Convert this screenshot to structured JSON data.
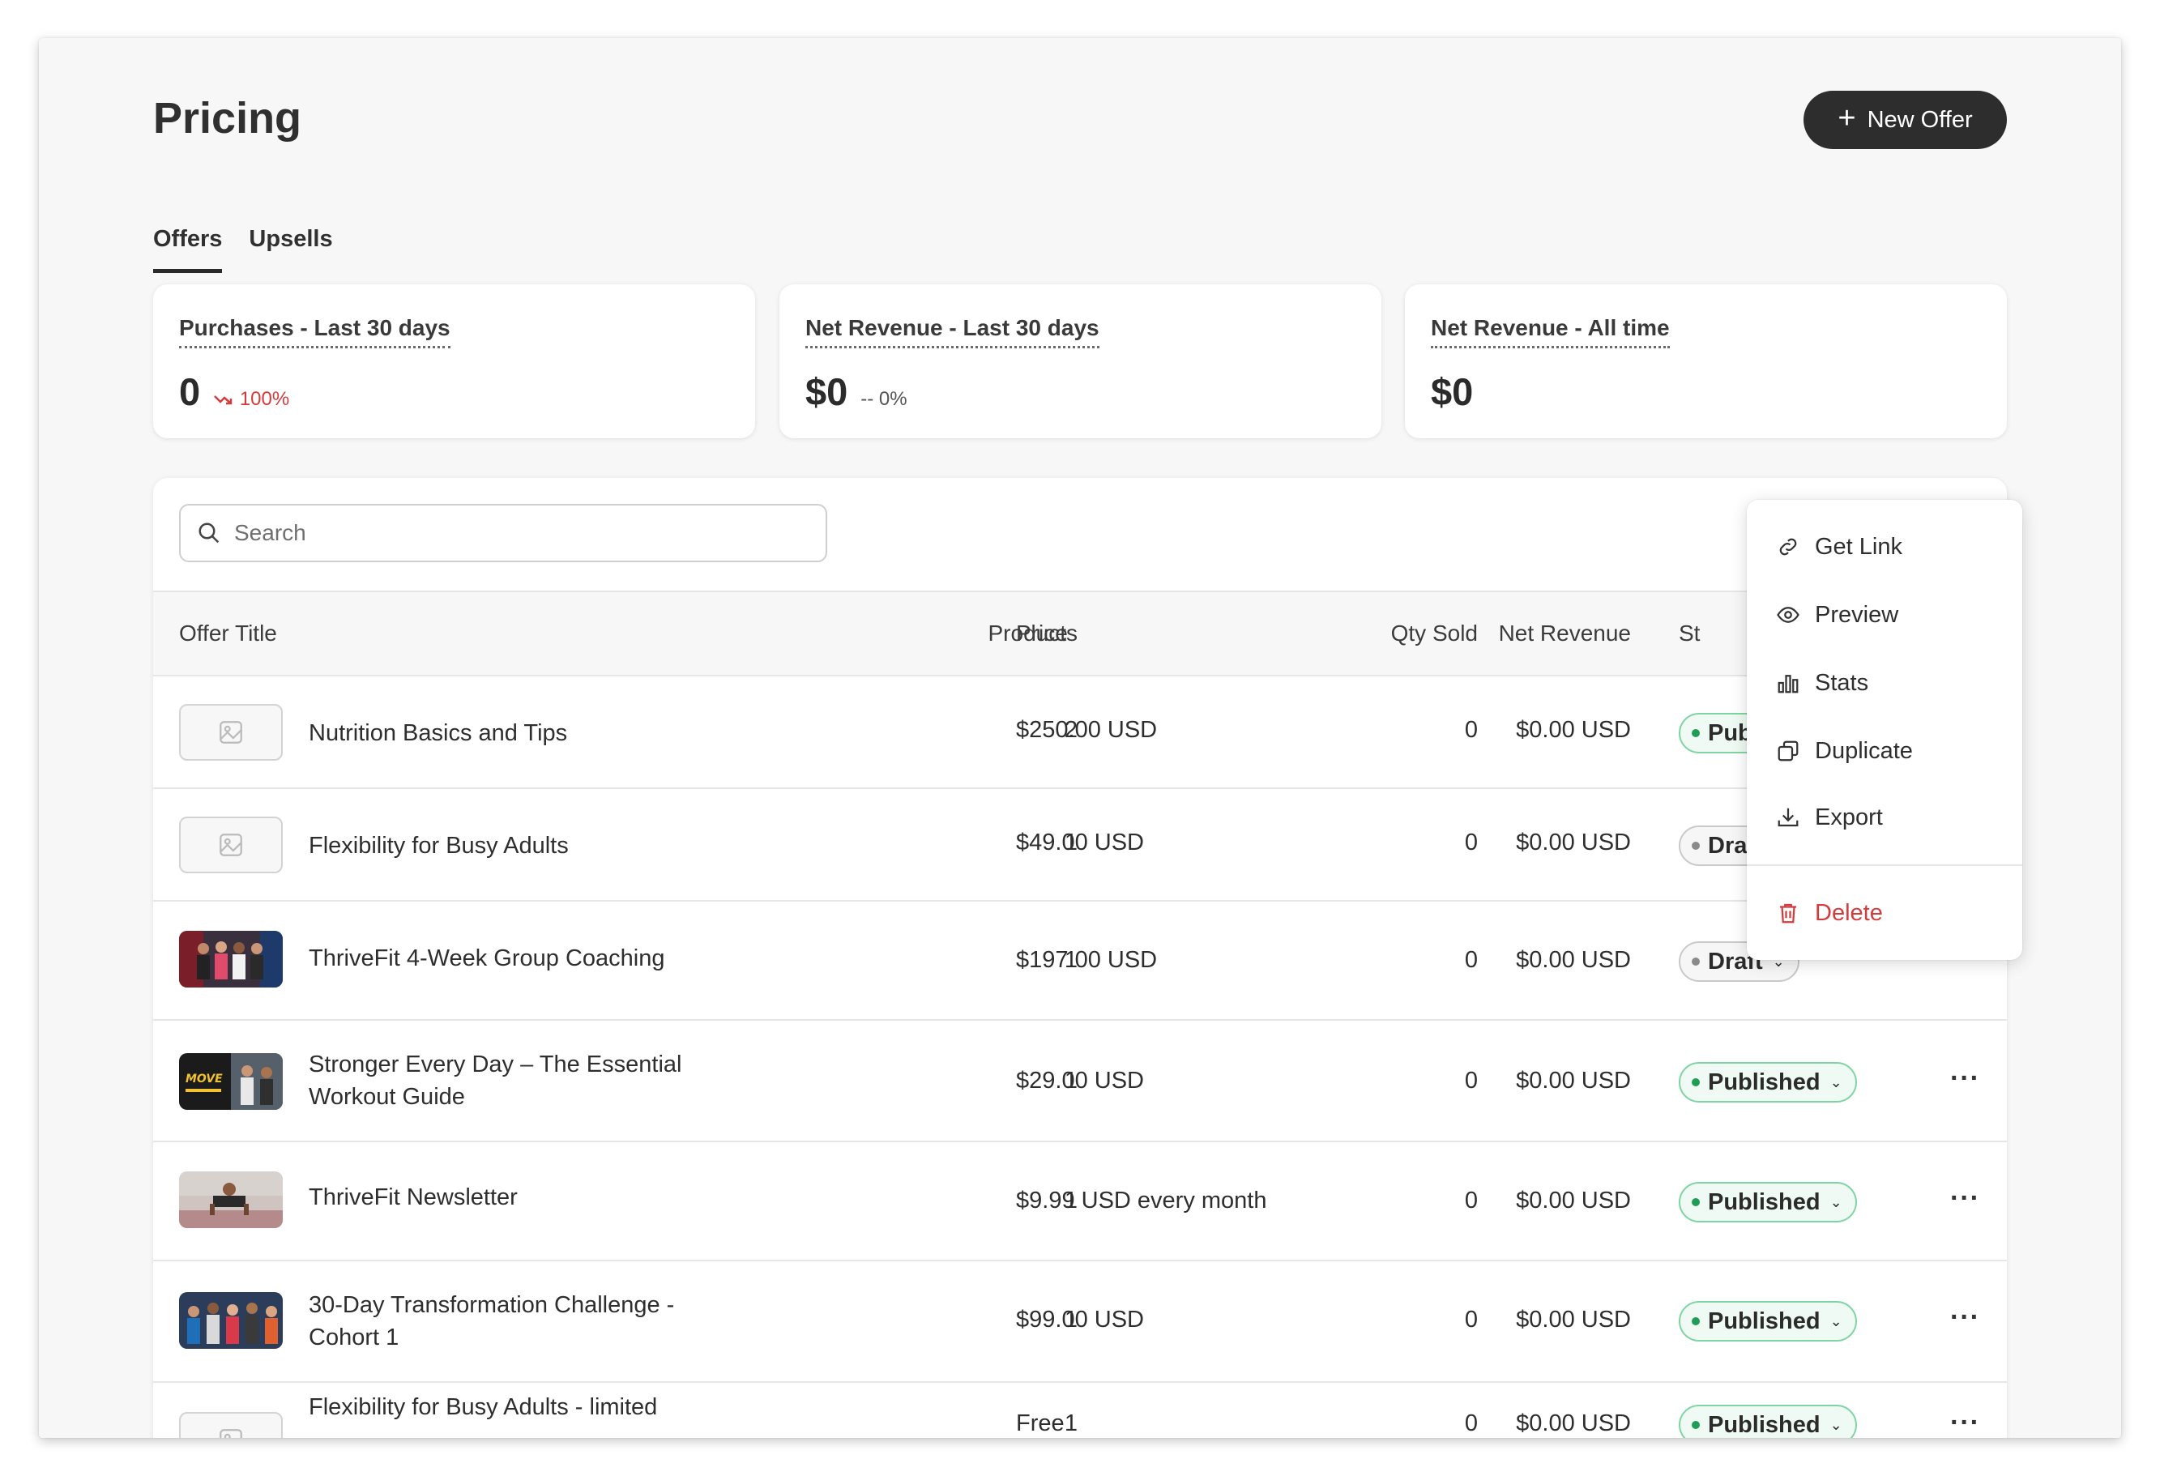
{
  "header": {
    "title": "Pricing",
    "new_offer_label": "New Offer"
  },
  "tabs": [
    {
      "label": "Offers",
      "active": true
    },
    {
      "label": "Upsells",
      "active": false
    }
  ],
  "stats": [
    {
      "label": "Purchases - Last 30 days",
      "value": "0",
      "change": "100%",
      "trend": "down"
    },
    {
      "label": "Net Revenue - Last 30 days",
      "value": "$0",
      "change": "-- 0%",
      "trend": "flat"
    },
    {
      "label": "Net Revenue - All time",
      "value": "$0",
      "change": ""
    }
  ],
  "search": {
    "placeholder": "Search",
    "value": ""
  },
  "table": {
    "columns": {
      "title": "Offer Title",
      "products": "Products",
      "price": "Price",
      "qty": "Qty Sold",
      "revenue": "Net Revenue",
      "status": "St"
    },
    "rows": [
      {
        "title": "Nutrition Basics and Tips",
        "products": "2",
        "price": "$250.00 USD",
        "qty": "0",
        "revenue": "$0.00 USD",
        "status": "Published",
        "thumb": "placeholder"
      },
      {
        "title": "Flexibility for Busy Adults",
        "products": "1",
        "price": "$49.00 USD",
        "qty": "0",
        "revenue": "$0.00 USD",
        "status": "Draft",
        "thumb": "placeholder"
      },
      {
        "title": "ThriveFit 4-Week Group Coaching",
        "products": "1",
        "price": "$197.00 USD",
        "qty": "0",
        "revenue": "$0.00 USD",
        "status": "Draft",
        "thumb": "group-photo"
      },
      {
        "title": "Stronger Every Day – The Essential Workout Guide",
        "products": "1",
        "price": "$29.00 USD",
        "qty": "0",
        "revenue": "$0.00 USD",
        "status": "Published",
        "thumb": "move-photo"
      },
      {
        "title": "ThriveFit Newsletter",
        "products": "1",
        "price": "$9.99 USD every month",
        "qty": "0",
        "revenue": "$0.00 USD",
        "status": "Published",
        "thumb": "pushup-photo"
      },
      {
        "title": "30-Day Transformation Challenge - Cohort 1",
        "products": "1",
        "price": "$99.00 USD",
        "qty": "0",
        "revenue": "$0.00 USD",
        "status": "Published",
        "thumb": "crowd-photo"
      },
      {
        "title": "Flexibility for Busy Adults - limited",
        "products": "1",
        "price": "Free",
        "qty": "0",
        "revenue": "$0.00 USD",
        "status": "Published",
        "thumb": "placeholder"
      }
    ]
  },
  "menu": {
    "items": [
      {
        "label": "Get Link",
        "icon": "link-icon"
      },
      {
        "label": "Preview",
        "icon": "eye-icon"
      },
      {
        "label": "Stats",
        "icon": "bar-chart-icon"
      },
      {
        "label": "Duplicate",
        "icon": "duplicate-icon"
      },
      {
        "label": "Export",
        "icon": "download-icon"
      },
      {
        "label": "Delete",
        "icon": "trash-icon"
      }
    ]
  },
  "colors": {
    "primary_button": "#2d2d2d",
    "published": "#1f9d55",
    "danger": "#d43c3c"
  }
}
